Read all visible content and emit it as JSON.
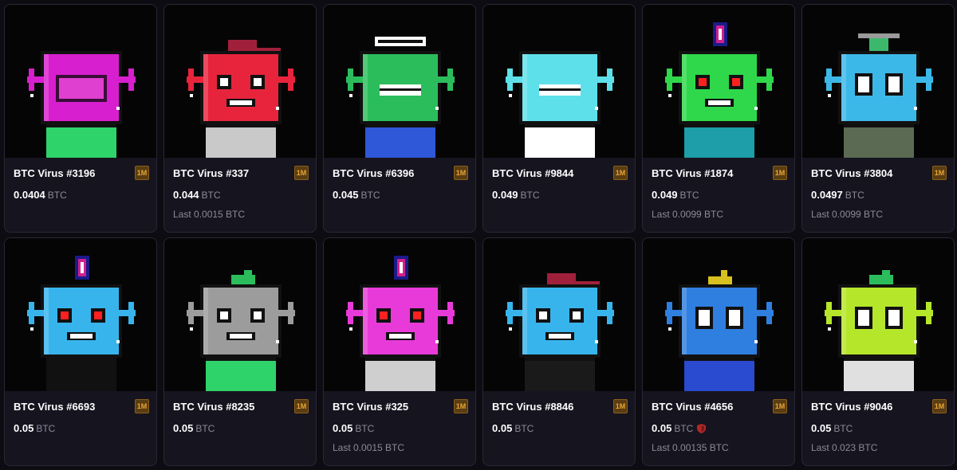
{
  "cards": [
    {
      "name": "BTC Virus #3196",
      "badge": "1M",
      "price": "0.0404",
      "currency": "BTC",
      "last": "",
      "icon": "robot-404-avatar",
      "colors": {
        "head": "#d81fcf",
        "body": "#2ed36a"
      }
    },
    {
      "name": "BTC Virus #337",
      "badge": "1M",
      "price": "0.044",
      "currency": "BTC",
      "last": "Last 0.0015 BTC",
      "icon": "robot-cap-avatar",
      "colors": {
        "head": "#e8243c",
        "body": "#c9c9c9"
      }
    },
    {
      "name": "BTC Virus #6396",
      "badge": "1M",
      "price": "0.045",
      "currency": "BTC",
      "last": "",
      "icon": "robot-zombie-avatar",
      "colors": {
        "head": "#2bbd5c",
        "body": "#2f58d8"
      }
    },
    {
      "name": "BTC Virus #9844",
      "badge": "1M",
      "price": "0.049",
      "currency": "BTC",
      "last": "",
      "icon": "robot-ice-avatar",
      "colors": {
        "head": "#5ee0ea",
        "body": "#ffffff"
      }
    },
    {
      "name": "BTC Virus #1874",
      "badge": "1M",
      "price": "0.049",
      "currency": "BTC",
      "last": "Last 0.0099 BTC",
      "icon": "robot-flame-avatar",
      "colors": {
        "head": "#2ed84a",
        "body": "#1d9ea8"
      }
    },
    {
      "name": "BTC Virus #3804",
      "badge": "1M",
      "price": "0.0497",
      "currency": "BTC",
      "last": "Last 0.0099 BTC",
      "icon": "robot-ufo-avatar",
      "colors": {
        "head": "#3cb8e8",
        "body": "#5b6a52"
      }
    },
    {
      "name": "BTC Virus #6693",
      "badge": "1M",
      "price": "0.05",
      "currency": "BTC",
      "last": "",
      "icon": "robot-flame-avatar",
      "colors": {
        "head": "#38b4ec",
        "body": "#111111"
      }
    },
    {
      "name": "BTC Virus #8235",
      "badge": "1M",
      "price": "0.05",
      "currency": "BTC",
      "last": "",
      "icon": "robot-mohawk-avatar",
      "colors": {
        "head": "#9c9c9c",
        "body": "#2ed36a"
      }
    },
    {
      "name": "BTC Virus #325",
      "badge": "1M",
      "price": "0.05",
      "currency": "BTC",
      "last": "Last 0.0015 BTC",
      "icon": "robot-flame-avatar",
      "colors": {
        "head": "#e83ad8",
        "body": "#cfcfcf"
      }
    },
    {
      "name": "BTC Virus #8846",
      "badge": "1M",
      "price": "0.05",
      "currency": "BTC",
      "last": "",
      "icon": "robot-cap-avatar",
      "colors": {
        "head": "#38b4ec",
        "body": "#1a1a1a"
      }
    },
    {
      "name": "BTC Virus #4656",
      "badge": "1M",
      "price": "0.05",
      "currency": "BTC",
      "last": "Last 0.00135 BTC",
      "icon": "robot-crown-avatar",
      "colors": {
        "head": "#2f7fe0",
        "body": "#2a4ad0"
      },
      "shield": true
    },
    {
      "name": "BTC Virus #9046",
      "badge": "1M",
      "price": "0.05",
      "currency": "BTC",
      "last": "Last 0.023 BTC",
      "icon": "robot-mohawk-avatar",
      "colors": {
        "head": "#b5e62a",
        "body": "#e0e0e0"
      }
    }
  ]
}
